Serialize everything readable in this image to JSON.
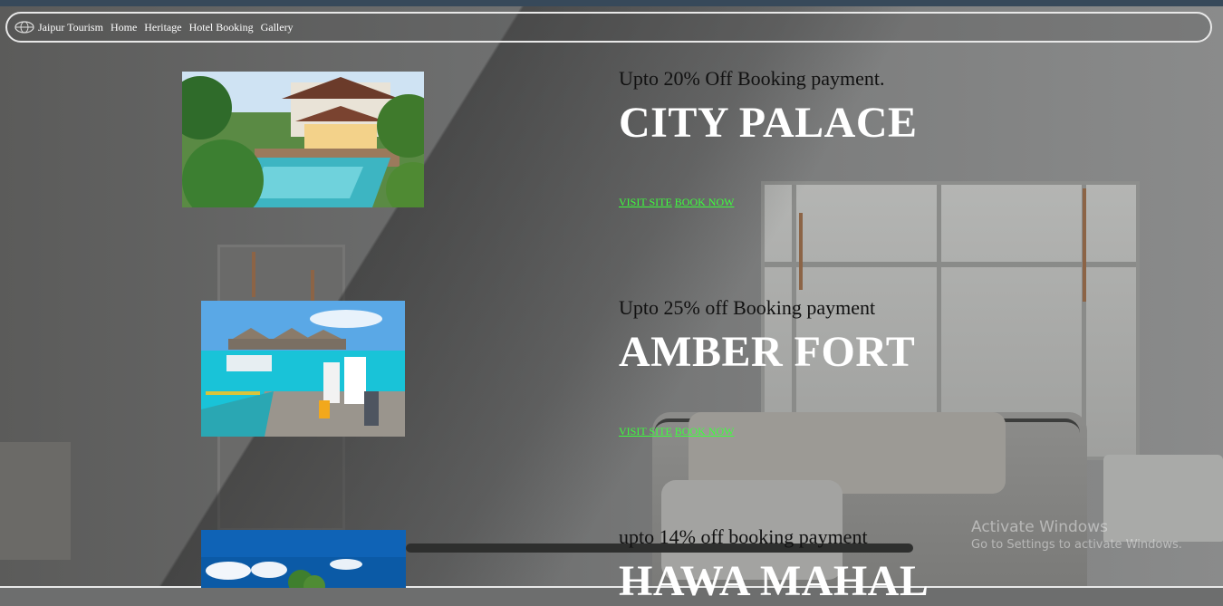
{
  "navbar": {
    "brand": "Jaipur Tourism",
    "items": [
      "Home",
      "Heritage",
      "Hotel Booking",
      "Gallery"
    ]
  },
  "offers": [
    {
      "discount": "Upto 20% Off Booking payment.",
      "place": "CITY PALACE",
      "visit_label": "VISIT SITE",
      "book_label": "BOOK NOW"
    },
    {
      "discount": "Upto 25% off Booking payment",
      "place": "AMBER FORT",
      "visit_label": "VISIT SITE",
      "book_label": "BOOK NOW"
    },
    {
      "discount": "upto 14% off booking payment",
      "place": "HAWA MAHAL"
    }
  ],
  "watermark": {
    "title": "Activate Windows",
    "subtitle": "Go to Settings to activate Windows."
  }
}
